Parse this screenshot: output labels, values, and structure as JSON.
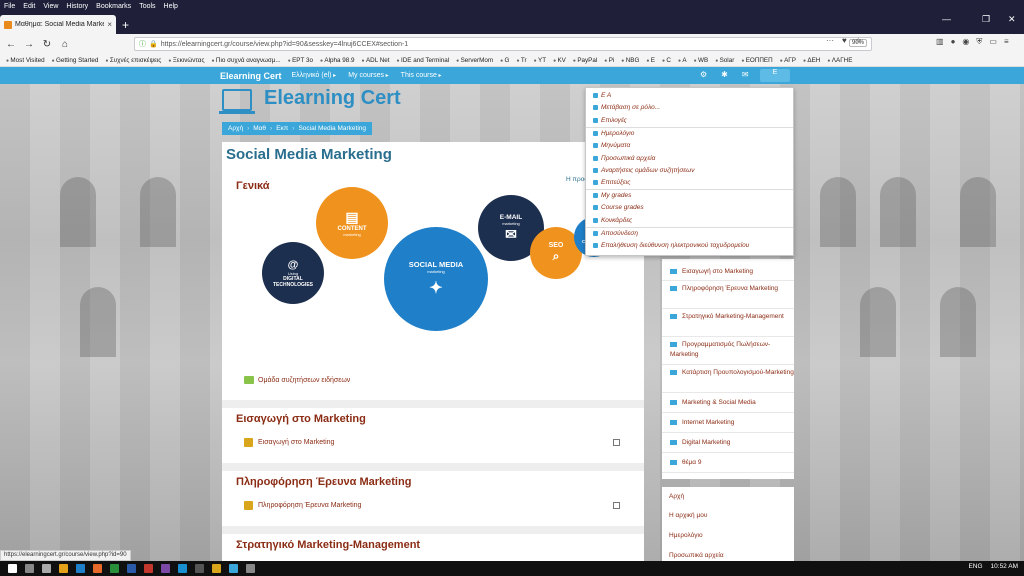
{
  "menubar": [
    "File",
    "Edit",
    "View",
    "History",
    "Bookmarks",
    "Tools",
    "Help"
  ],
  "tab": {
    "title": "Μαθημα: Social Media Marketi",
    "close": "×"
  },
  "browser": {
    "url": "https://elearningcert.gr/course/view.php?id=90&sesskey=4lnuj6CCEX#section-1",
    "zoom": "90%"
  },
  "bookmarks": [
    "Most Visited",
    "Getting Started",
    "Συχνές επισκέψεις",
    "Ξεκινώντας",
    "Πιο συχνά αναγνωσμ...",
    "ΕΡΤ 3o",
    "Alpha 98.9",
    "ADL Net",
    "IDE and Terminal",
    "ServerMom",
    "G",
    "Tr",
    "YT",
    "KV",
    "PayPal",
    "Pi",
    "NBG",
    "E",
    "C",
    "A",
    "WB",
    "Solar",
    "ΕΟΠΠΕΠ",
    "ΑΓΡ",
    "ΔΕΗ",
    "ΛΑΓΗΕ"
  ],
  "sitenav": {
    "brand": "Elearning Cert",
    "lang": "Ελληνικό (el)",
    "my_courses": "My courses",
    "this_course": "This course",
    "user": "E"
  },
  "header": {
    "site_title": "Elearning Cert"
  },
  "breadcrumb": [
    "Αρχή",
    "Μαθ",
    "Εκπ",
    "Social Media Marketing"
  ],
  "main": {
    "course_title": "Social Media Marketing",
    "edit_link": "Η προσθ",
    "general_title": "Γενικά",
    "forum_link": "Ομάδα συζητήσεων ειδήσεων",
    "illustration": {
      "content": "CONTENT",
      "content_sub": "marketing",
      "social": "SOCIAL MEDIA",
      "social_sub": "marketing",
      "email": "E-MAIL",
      "email_sub": "marketing",
      "seo": "SEO",
      "campaign": "CAMPAIGN",
      "digital": "DIGITAL",
      "digital2": "TECHNOLOGIES",
      "digital_sub": "Using"
    },
    "sections": [
      {
        "title": "Εισαγωγή στο Marketing",
        "item": "Εισαγωγή στο Marketing"
      },
      {
        "title": "Πληροφόρηση Έρευνα Marketing",
        "item": "Πληροφόρηση Έρευνα Marketing"
      },
      {
        "title": "Στρατηγικό Marketing-Management",
        "item": ""
      }
    ]
  },
  "sidebar": {
    "items": [
      "Εισαγωγή στο Marketing",
      "Πληροφόρηση Έρευνα Marketing",
      "Στρατηγικό Marketing-Management",
      "Προγραμματισμός Πωλήσεων-Marketing",
      "Κατάρτιση Προυπολογισμού-Marketing",
      "Marketing & Social Media",
      "Internet Marketing",
      "Digital Marketing",
      "θέμα 9"
    ],
    "nav": [
      "Αρχή",
      "Η αρχική μου",
      "Ημερολόγιο",
      "Προσωπικά αρχεία"
    ]
  },
  "dropdown": {
    "items": [
      "E A",
      "Μετάβαση σε ρόλο...",
      "Επιλογές",
      "Ημερολόγιο",
      "Μηνύματα",
      "Προσωπικά αρχεία",
      "Αναρτήσεις ομάδων συζητήσεων",
      "Επιτεύξεις",
      "My grades",
      "Course grades",
      "Κονκάρδες",
      "Αποσύνδεση",
      "Επαλήθευση διεύθυνση ηλεκτρονικού ταχυδρομείου"
    ]
  },
  "status_url": "https://elearningcert.gr/course/view.php?id=90",
  "taskbar": {
    "lang": "ENG",
    "time": "10:52 AM"
  },
  "colors": {
    "accent": "#3aa6d9",
    "title": "#2a6e8f",
    "section": "#8b2c14"
  }
}
